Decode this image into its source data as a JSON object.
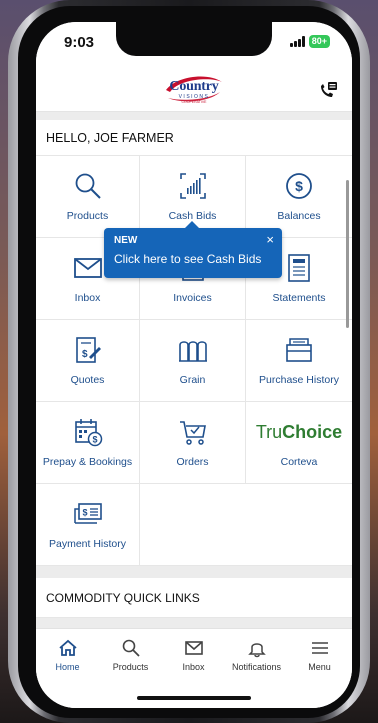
{
  "status_bar": {
    "time": "9:03",
    "battery": "80+"
  },
  "header": {
    "logo_word": "Country",
    "logo_sub": "VISIONS",
    "logo_sub2": "COOPERATIVE",
    "contact_icon": "phone-list-icon"
  },
  "greeting": "HELLO, JOE FARMER",
  "tiles": [
    {
      "label": "Products",
      "icon": "search-icon"
    },
    {
      "label": "Cash Bids",
      "icon": "barcode-chart-icon"
    },
    {
      "label": "Balances",
      "icon": "dollar-circle-icon"
    },
    {
      "label": "Inbox",
      "icon": "envelope-icon"
    },
    {
      "label": "Invoices",
      "icon": "invoice-icon"
    },
    {
      "label": "Statements",
      "icon": "statement-icon"
    },
    {
      "label": "Quotes",
      "icon": "quote-icon"
    },
    {
      "label": "Grain",
      "icon": "grain-bins-icon"
    },
    {
      "label": "Purchase History",
      "icon": "archive-box-icon"
    },
    {
      "label": "Prepay & Bookings",
      "icon": "calendar-dollar-icon"
    },
    {
      "label": "Orders",
      "icon": "cart-icon"
    },
    {
      "label": "Corteva",
      "icon": "truchoice-logo",
      "logo_a": "Tru",
      "logo_b": "Choice"
    },
    {
      "label": "Payment History",
      "icon": "bill-icon"
    }
  ],
  "tooltip": {
    "title": "NEW",
    "text": "Click here to see Cash Bids",
    "close": "×"
  },
  "commodity_header": "COMMODITY QUICK LINKS",
  "tabbar": [
    {
      "label": "Home",
      "icon": "home-icon",
      "active": true
    },
    {
      "label": "Products",
      "icon": "search-icon",
      "active": false
    },
    {
      "label": "Inbox",
      "icon": "envelope-icon",
      "active": false
    },
    {
      "label": "Notifications",
      "icon": "bell-icon",
      "active": false
    },
    {
      "label": "Menu",
      "icon": "hamburger-menu-icon",
      "active": false
    }
  ],
  "colors": {
    "accent": "#1f4f8c",
    "tooltip": "#1565b8",
    "truchoice": "#2f7d32"
  }
}
